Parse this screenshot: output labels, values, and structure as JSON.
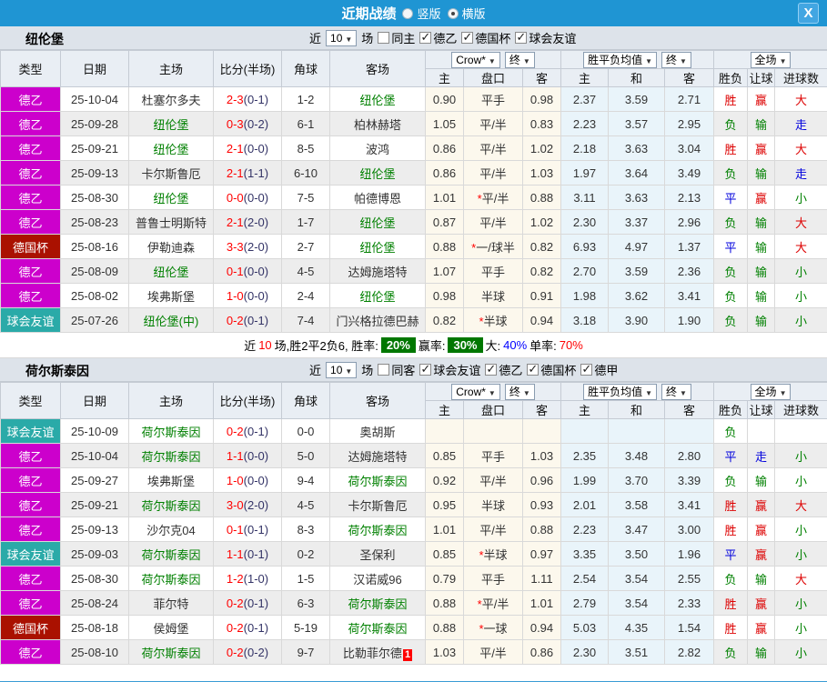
{
  "titlebar": {
    "title": "近期战绩",
    "radios": [
      {
        "label": "竖版",
        "checked": false
      },
      {
        "label": "横版",
        "checked": true
      }
    ],
    "close_label": "X"
  },
  "table_headers": {
    "type": "类型",
    "date": "日期",
    "home": "主场",
    "score": "比分(半场)",
    "corner": "角球",
    "away": "客场",
    "odds_source": "Crow*",
    "odds_final": "终",
    "mean_label": "胜平负均值",
    "mean_final": "终",
    "fullmatch": "全场",
    "odds_home": "主",
    "odds_handicap": "盘口",
    "odds_away": "客",
    "mean_home": "主",
    "mean_draw": "和",
    "mean_away": "客",
    "result": "胜负",
    "handicap_result": "让球",
    "goal_result": "进球数"
  },
  "teams": [
    {
      "name": "纽伦堡",
      "filter": {
        "prefix": "近",
        "count": "10",
        "suffix": "场",
        "same_label": "同主",
        "same_checked": false,
        "leagues": [
          "德乙",
          "德国杯",
          "球会友谊"
        ]
      },
      "rows": [
        {
          "type": "德乙",
          "date": "25-10-04",
          "home": "杜塞尔多夫",
          "home_self": false,
          "score": "2-3",
          "half": "(0-1)",
          "corner": "1-2",
          "away": "纽伦堡",
          "away_self": true,
          "away_badge": "",
          "o_h": "0.90",
          "handicap": "平手",
          "star": false,
          "o_a": "0.98",
          "m_h": "2.37",
          "m_d": "3.59",
          "m_a": "2.71",
          "r": "胜",
          "rb": "赢",
          "g": "大"
        },
        {
          "type": "德乙",
          "date": "25-09-28",
          "home": "纽伦堡",
          "home_self": true,
          "score": "0-3",
          "half": "(0-2)",
          "corner": "6-1",
          "away": "柏林赫塔",
          "away_self": false,
          "away_badge": "",
          "o_h": "1.05",
          "handicap": "平/半",
          "star": false,
          "o_a": "0.83",
          "m_h": "2.23",
          "m_d": "3.57",
          "m_a": "2.95",
          "r": "负",
          "rb": "输",
          "g": "走"
        },
        {
          "type": "德乙",
          "date": "25-09-21",
          "home": "纽伦堡",
          "home_self": true,
          "score": "2-1",
          "half": "(0-0)",
          "corner": "8-5",
          "away": "波鸿",
          "away_self": false,
          "away_badge": "",
          "o_h": "0.86",
          "handicap": "平/半",
          "star": false,
          "o_a": "1.02",
          "m_h": "2.18",
          "m_d": "3.63",
          "m_a": "3.04",
          "r": "胜",
          "rb": "赢",
          "g": "大"
        },
        {
          "type": "德乙",
          "date": "25-09-13",
          "home": "卡尔斯鲁厄",
          "home_self": false,
          "score": "2-1",
          "half": "(1-1)",
          "corner": "6-10",
          "away": "纽伦堡",
          "away_self": true,
          "away_badge": "",
          "o_h": "0.86",
          "handicap": "平/半",
          "star": false,
          "o_a": "1.03",
          "m_h": "1.97",
          "m_d": "3.64",
          "m_a": "3.49",
          "r": "负",
          "rb": "输",
          "g": "走"
        },
        {
          "type": "德乙",
          "date": "25-08-30",
          "home": "纽伦堡",
          "home_self": true,
          "score": "0-0",
          "half": "(0-0)",
          "corner": "7-5",
          "away": "帕德博恩",
          "away_self": false,
          "away_badge": "",
          "o_h": "1.01",
          "handicap": "平/半",
          "star": true,
          "o_a": "0.88",
          "m_h": "3.11",
          "m_d": "3.63",
          "m_a": "2.13",
          "r": "平",
          "rb": "赢",
          "g": "小"
        },
        {
          "type": "德乙",
          "date": "25-08-23",
          "home": "普鲁士明斯特",
          "home_self": false,
          "score": "2-1",
          "half": "(2-0)",
          "corner": "1-7",
          "away": "纽伦堡",
          "away_self": true,
          "away_badge": "",
          "o_h": "0.87",
          "handicap": "平/半",
          "star": false,
          "o_a": "1.02",
          "m_h": "2.30",
          "m_d": "3.37",
          "m_a": "2.96",
          "r": "负",
          "rb": "输",
          "g": "大"
        },
        {
          "type": "德国杯",
          "date": "25-08-16",
          "home": "伊勒迪森",
          "home_self": false,
          "score": "3-3",
          "half": "(2-0)",
          "corner": "2-7",
          "away": "纽伦堡",
          "away_self": true,
          "away_badge": "",
          "o_h": "0.88",
          "handicap": "一/球半",
          "star": true,
          "o_a": "0.82",
          "m_h": "6.93",
          "m_d": "4.97",
          "m_a": "1.37",
          "r": "平",
          "rb": "输",
          "g": "大"
        },
        {
          "type": "德乙",
          "date": "25-08-09",
          "home": "纽伦堡",
          "home_self": true,
          "score": "0-1",
          "half": "(0-0)",
          "corner": "4-5",
          "away": "达姆施塔特",
          "away_self": false,
          "away_badge": "",
          "o_h": "1.07",
          "handicap": "平手",
          "star": false,
          "o_a": "0.82",
          "m_h": "2.70",
          "m_d": "3.59",
          "m_a": "2.36",
          "r": "负",
          "rb": "输",
          "g": "小"
        },
        {
          "type": "德乙",
          "date": "25-08-02",
          "home": "埃弗斯堡",
          "home_self": false,
          "score": "1-0",
          "half": "(0-0)",
          "corner": "2-4",
          "away": "纽伦堡",
          "away_self": true,
          "away_badge": "",
          "o_h": "0.98",
          "handicap": "半球",
          "star": false,
          "o_a": "0.91",
          "m_h": "1.98",
          "m_d": "3.62",
          "m_a": "3.41",
          "r": "负",
          "rb": "输",
          "g": "小"
        },
        {
          "type": "球会友谊",
          "date": "25-07-26",
          "home": "纽伦堡(中)",
          "home_self": true,
          "score": "0-2",
          "half": "(0-1)",
          "corner": "7-4",
          "away": "门兴格拉德巴赫",
          "away_self": false,
          "away_badge": "",
          "o_h": "0.82",
          "handicap": "半球",
          "star": true,
          "o_a": "0.94",
          "m_h": "3.18",
          "m_d": "3.90",
          "m_a": "1.90",
          "r": "负",
          "rb": "输",
          "g": "小"
        }
      ],
      "summary_parts": [
        {
          "text": "近",
          "style": "plain"
        },
        {
          "text": "10",
          "style": "red"
        },
        {
          "text": "场,胜2平2负6, 胜率:",
          "style": "plain"
        },
        {
          "text": "20%",
          "style": "pct"
        },
        {
          "text": "赢率:",
          "style": "plain"
        },
        {
          "text": "30%",
          "style": "pct"
        },
        {
          "text": "大:",
          "style": "plain"
        },
        {
          "text": "40%",
          "style": "blue"
        },
        {
          "text": "单率:",
          "style": "plain"
        },
        {
          "text": "70%",
          "style": "red"
        }
      ]
    },
    {
      "name": "荷尔斯泰因",
      "filter": {
        "prefix": "近",
        "count": "10",
        "suffix": "场",
        "same_label": "同客",
        "same_checked": false,
        "leagues": [
          "球会友谊",
          "德乙",
          "德国杯",
          "德甲"
        ]
      },
      "rows": [
        {
          "type": "球会友谊",
          "date": "25-10-09",
          "home": "荷尔斯泰因",
          "home_self": true,
          "score": "0-2",
          "half": "(0-1)",
          "corner": "0-0",
          "away": "奥胡斯",
          "away_self": false,
          "away_badge": "",
          "o_h": "",
          "handicap": "",
          "star": false,
          "o_a": "",
          "m_h": "",
          "m_d": "",
          "m_a": "",
          "r": "负",
          "rb": "",
          "g": ""
        },
        {
          "type": "德乙",
          "date": "25-10-04",
          "home": "荷尔斯泰因",
          "home_self": true,
          "score": "1-1",
          "half": "(0-0)",
          "corner": "5-0",
          "away": "达姆施塔特",
          "away_self": false,
          "away_badge": "",
          "o_h": "0.85",
          "handicap": "平手",
          "star": false,
          "o_a": "1.03",
          "m_h": "2.35",
          "m_d": "3.48",
          "m_a": "2.80",
          "r": "平",
          "rb": "走",
          "g": "小"
        },
        {
          "type": "德乙",
          "date": "25-09-27",
          "home": "埃弗斯堡",
          "home_self": false,
          "score": "1-0",
          "half": "(0-0)",
          "corner": "9-4",
          "away": "荷尔斯泰因",
          "away_self": true,
          "away_badge": "",
          "o_h": "0.92",
          "handicap": "平/半",
          "star": false,
          "o_a": "0.96",
          "m_h": "1.99",
          "m_d": "3.70",
          "m_a": "3.39",
          "r": "负",
          "rb": "输",
          "g": "小"
        },
        {
          "type": "德乙",
          "date": "25-09-21",
          "home": "荷尔斯泰因",
          "home_self": true,
          "score": "3-0",
          "half": "(2-0)",
          "corner": "4-5",
          "away": "卡尔斯鲁厄",
          "away_self": false,
          "away_badge": "",
          "o_h": "0.95",
          "handicap": "半球",
          "star": false,
          "o_a": "0.93",
          "m_h": "2.01",
          "m_d": "3.58",
          "m_a": "3.41",
          "r": "胜",
          "rb": "赢",
          "g": "大"
        },
        {
          "type": "德乙",
          "date": "25-09-13",
          "home": "沙尔克04",
          "home_self": false,
          "score": "0-1",
          "half": "(0-1)",
          "corner": "8-3",
          "away": "荷尔斯泰因",
          "away_self": true,
          "away_badge": "",
          "o_h": "1.01",
          "handicap": "平/半",
          "star": false,
          "o_a": "0.88",
          "m_h": "2.23",
          "m_d": "3.47",
          "m_a": "3.00",
          "r": "胜",
          "rb": "赢",
          "g": "小"
        },
        {
          "type": "球会友谊",
          "date": "25-09-03",
          "home": "荷尔斯泰因",
          "home_self": true,
          "score": "1-1",
          "half": "(0-1)",
          "corner": "0-2",
          "away": "圣保利",
          "away_self": false,
          "away_badge": "",
          "o_h": "0.85",
          "handicap": "半球",
          "star": true,
          "o_a": "0.97",
          "m_h": "3.35",
          "m_d": "3.50",
          "m_a": "1.96",
          "r": "平",
          "rb": "赢",
          "g": "小"
        },
        {
          "type": "德乙",
          "date": "25-08-30",
          "home": "荷尔斯泰因",
          "home_self": true,
          "score": "1-2",
          "half": "(1-0)",
          "corner": "1-5",
          "away": "汉诺威96",
          "away_self": false,
          "away_badge": "",
          "o_h": "0.79",
          "handicap": "平手",
          "star": false,
          "o_a": "1.11",
          "m_h": "2.54",
          "m_d": "3.54",
          "m_a": "2.55",
          "r": "负",
          "rb": "输",
          "g": "大"
        },
        {
          "type": "德乙",
          "date": "25-08-24",
          "home": "菲尔特",
          "home_self": false,
          "score": "0-2",
          "half": "(0-1)",
          "corner": "6-3",
          "away": "荷尔斯泰因",
          "away_self": true,
          "away_badge": "",
          "o_h": "0.88",
          "handicap": "平/半",
          "star": true,
          "o_a": "1.01",
          "m_h": "2.79",
          "m_d": "3.54",
          "m_a": "2.33",
          "r": "胜",
          "rb": "赢",
          "g": "小"
        },
        {
          "type": "德国杯",
          "date": "25-08-18",
          "home": "侯姆堡",
          "home_self": false,
          "score": "0-2",
          "half": "(0-1)",
          "corner": "5-19",
          "away": "荷尔斯泰因",
          "away_self": true,
          "away_badge": "",
          "o_h": "0.88",
          "handicap": "一球",
          "star": true,
          "o_a": "0.94",
          "m_h": "5.03",
          "m_d": "4.35",
          "m_a": "1.54",
          "r": "胜",
          "rb": "赢",
          "g": "小"
        },
        {
          "type": "德乙",
          "date": "25-08-10",
          "home": "荷尔斯泰因",
          "home_self": true,
          "score": "0-2",
          "half": "(0-2)",
          "corner": "9-7",
          "away": "比勒菲尔德",
          "away_self": false,
          "away_badge": "1",
          "o_h": "1.03",
          "handicap": "平/半",
          "star": false,
          "o_a": "0.86",
          "m_h": "2.30",
          "m_d": "3.51",
          "m_a": "2.82",
          "r": "负",
          "rb": "输",
          "g": "小"
        }
      ],
      "summary_parts": []
    }
  ]
}
